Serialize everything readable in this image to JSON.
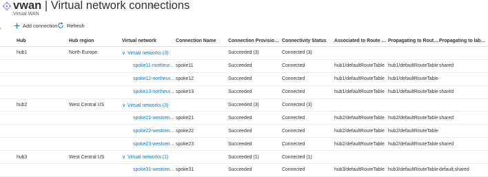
{
  "header": {
    "title_bold": "vwan",
    "title_rest": " | Virtual network connections",
    "subtitle": "Virtual WAN",
    "star": "☆",
    "more": "···"
  },
  "toolbar": {
    "add_label": "Add connection",
    "refresh_label": "Refresh"
  },
  "colors": {
    "accent": "#0078d4",
    "text": "#323130",
    "border": "#edebe9"
  },
  "table": {
    "columns": [
      "Hub",
      "Hub region",
      "Virtual network",
      "Connection Name",
      "Connection Provisioni...",
      "Connectivity Status",
      "Associated to Route Ta...",
      "Propagating to Route ...",
      "Propagating to label(s)"
    ],
    "rows": [
      {
        "hub": "hub1",
        "region": "North Europe",
        "vnet": "Virtual networks (3)",
        "conn": "",
        "prov": "Succeeded (3)",
        "status": "Connected (3)",
        "assoc": "",
        "prop": "",
        "labels": ""
      },
      {
        "hub": "",
        "region": "",
        "vnet": "spoke11-northeur...",
        "conn": "spoke11",
        "prov": "Succeeded",
        "status": "Connected",
        "assoc": "hub1/defaultRouteTable",
        "prop": "hub1/defaultRouteTable",
        "labels": "shared"
      },
      {
        "hub": "",
        "region": "",
        "vnet": "spoke12-northeur...",
        "conn": "spoke12",
        "prov": "Succeeded",
        "status": "Connected",
        "assoc": "hub1/defaultRouteTable",
        "prop": "hub1/defaultRouteTable",
        "labels": ""
      },
      {
        "hub": "",
        "region": "",
        "vnet": "spoke13-northeur...",
        "conn": "spoke13",
        "prov": "Succeeded",
        "status": "Connected",
        "assoc": "hub1/defaultRouteTable",
        "prop": "hub1/defaultRouteTable",
        "labels": "shared"
      },
      {
        "hub": "hub2",
        "region": "West Central US",
        "vnet": "Virtual networks (3)",
        "conn": "",
        "prov": "Succeeded (3)",
        "status": "Connected (3)",
        "assoc": "",
        "prop": "",
        "labels": ""
      },
      {
        "hub": "",
        "region": "",
        "vnet": "spoke21-westcen...",
        "conn": "spoke21",
        "prov": "Succeeded",
        "status": "Connected",
        "assoc": "hub2/defaultRouteTable",
        "prop": "hub2/defaultRouteTable",
        "labels": "shared"
      },
      {
        "hub": "",
        "region": "",
        "vnet": "spoke22-westcen...",
        "conn": "spoke22",
        "prov": "Succeeded",
        "status": "Connected",
        "assoc": "hub2/defaultRouteTable",
        "prop": "hub2/defaultRouteTable",
        "labels": ""
      },
      {
        "hub": "",
        "region": "",
        "vnet": "spoke23-westcen...",
        "conn": "spoke23",
        "prov": "Succeeded",
        "status": "Connected",
        "assoc": "hub2/defaultRouteTable",
        "prop": "hub2/defaultRouteTable",
        "labels": "shared"
      },
      {
        "hub": "hub3",
        "region": "West Central US",
        "vnet": "Virtual networks (1)",
        "conn": "",
        "prov": "Succeeded (1)",
        "status": "Connected (1)",
        "assoc": "",
        "prop": "",
        "labels": ""
      },
      {
        "hub": "",
        "region": "",
        "vnet": "spoke31-westcen...",
        "conn": "spoke31",
        "prov": "Succeeded",
        "status": "Connected",
        "assoc": "hub3/defaultRouteTable",
        "prop": "hub3/defaultRouteTable",
        "labels": "default,shared"
      }
    ]
  }
}
